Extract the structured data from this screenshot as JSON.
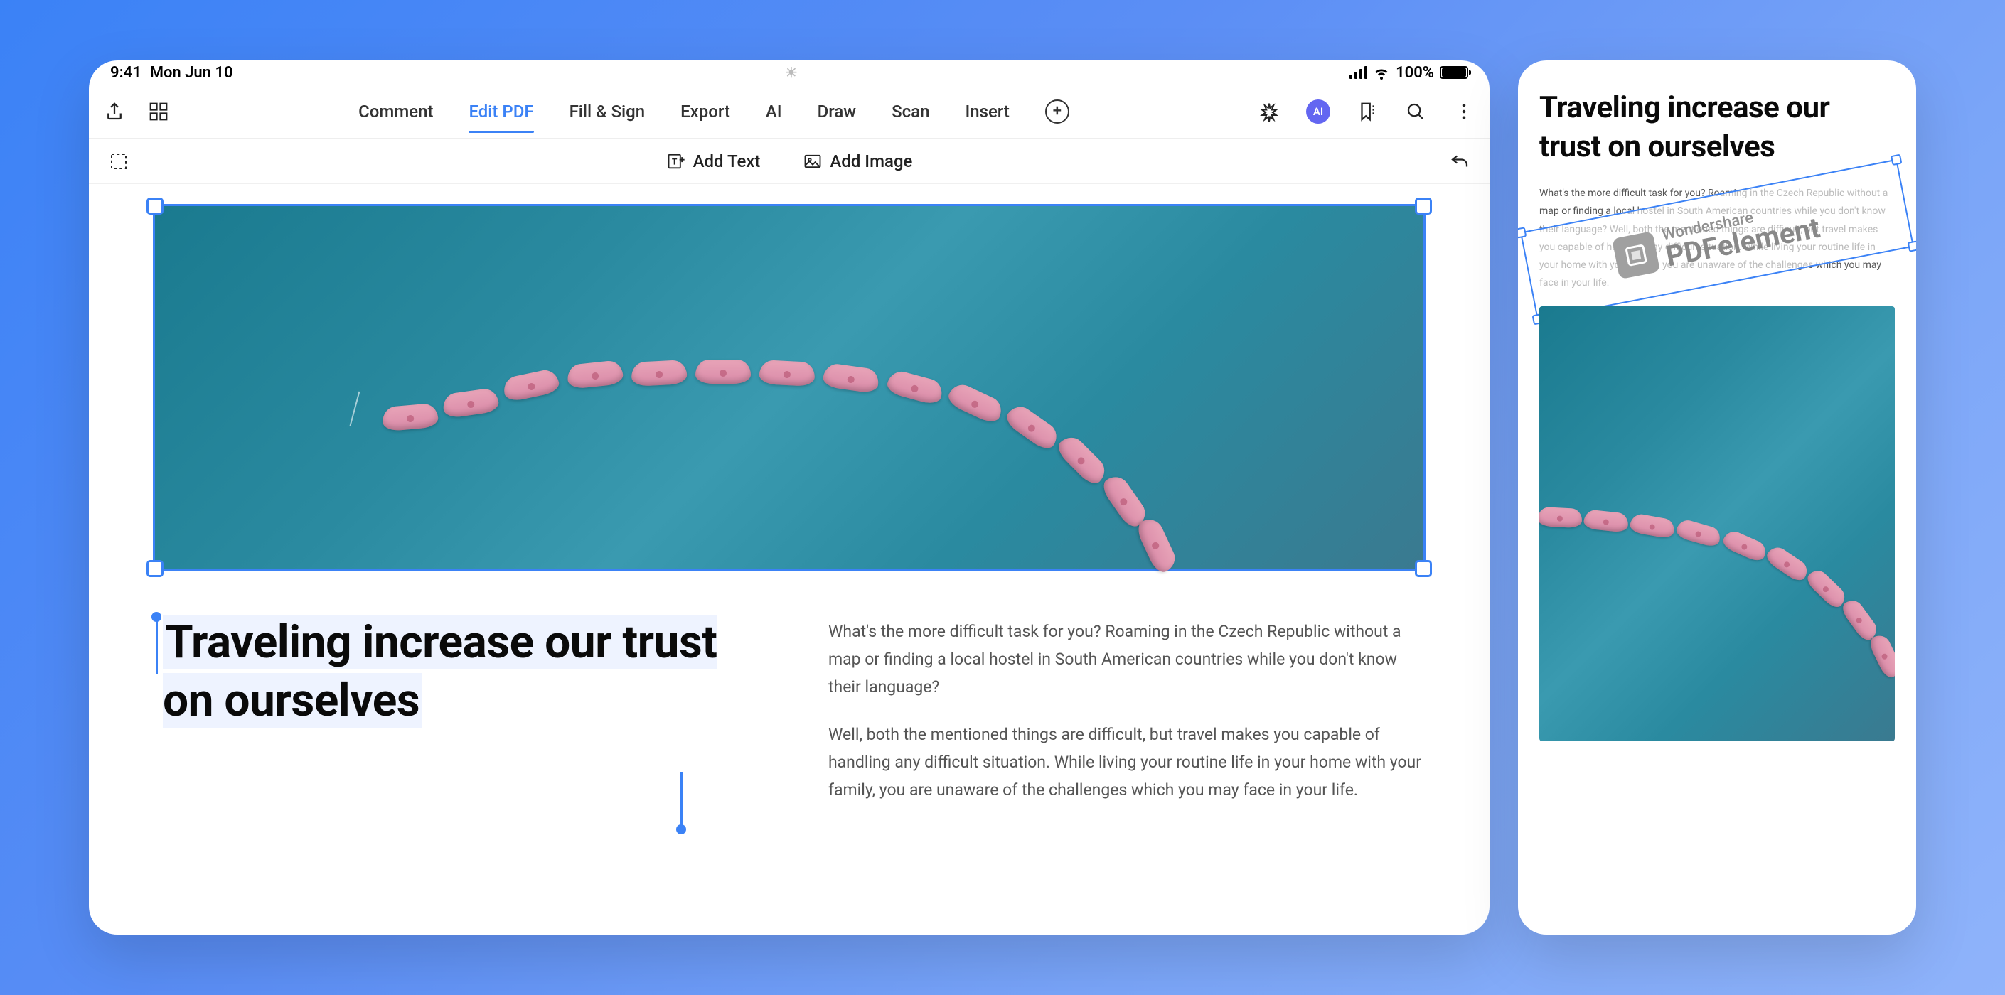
{
  "status": {
    "time": "9:41",
    "date": "Mon Jun 10",
    "battery": "100%"
  },
  "toolbar": {
    "tabs": {
      "comment": "Comment",
      "edit": "Edit PDF",
      "fillsign": "Fill & Sign",
      "export": "Export",
      "ai": "AI",
      "draw": "Draw",
      "scan": "Scan",
      "insert": "Insert"
    },
    "ai_badge": "AI"
  },
  "subtoolbar": {
    "add_text": "Add Text",
    "add_image": "Add Image"
  },
  "document": {
    "heading": "Traveling increase our trust on ourselves",
    "para1": "What's the more difficult task for you? Roaming in the Czech Republic without a map or finding a local hostel in South American countries while you don't know their language?",
    "para2": "Well, both the mentioned things are difficult, but travel makes you capable of handling any difficult situation. While living your routine life in your home with your family, you are unaware of the challenges which you may face in your life."
  },
  "phone": {
    "heading": "Traveling increase our trust on ourselves",
    "body": "What's the more difficult task for you? Roaming in the Czech Republic without a map or finding a local hostel in South American countries while you don't know their language? Well, both the mentioned things are difficult, but travel makes you capable of handling any difficult situation. While living your routine life in your home with your family, you are unaware of the challenges which you may face in your life.",
    "watermark": {
      "brand": "Wondershare",
      "product": "PDFelement"
    }
  },
  "colors": {
    "accent": "#3b82f6"
  }
}
